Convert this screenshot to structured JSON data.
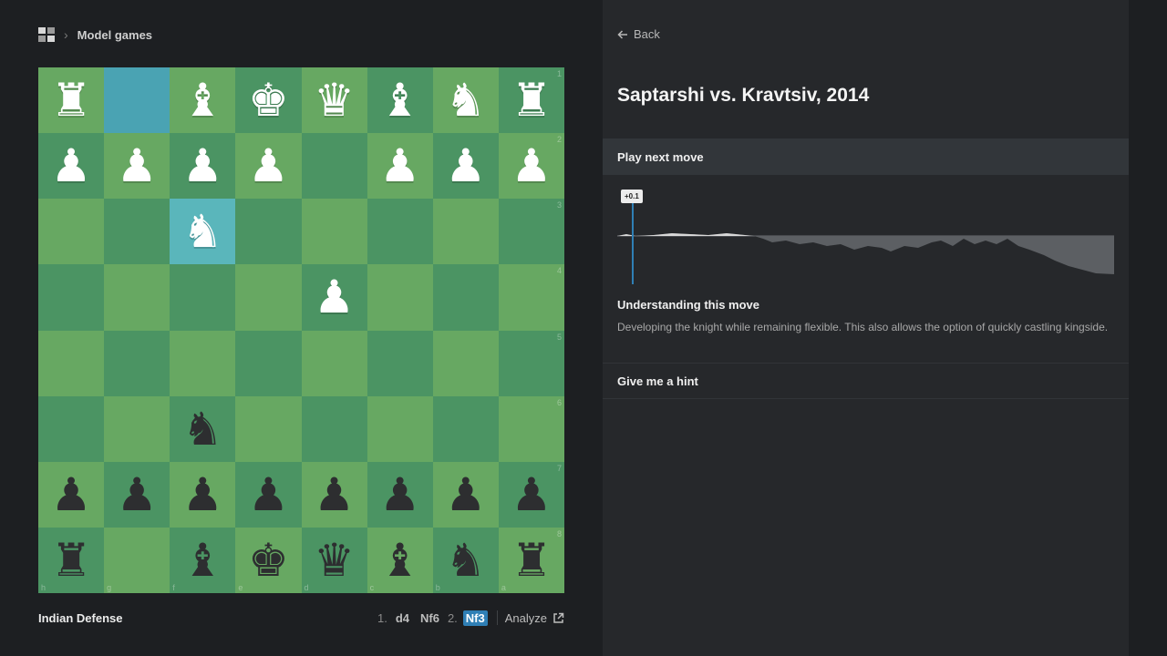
{
  "breadcrumb": {
    "section": "Model games"
  },
  "board": {
    "squares": [
      [
        "♜",
        "",
        "♝",
        "♚",
        "♛",
        "♝",
        "♞",
        "♜"
      ],
      [
        "♟",
        "♟",
        "♟",
        "♟",
        "",
        "♟",
        "♟",
        "♟"
      ],
      [
        "",
        "",
        "♞",
        "",
        "",
        "",
        "",
        ""
      ],
      [
        "",
        "",
        "",
        "",
        "♟",
        "",
        "",
        ""
      ],
      [
        "",
        "",
        "",
        "",
        "",
        "",
        "",
        ""
      ],
      [
        "",
        "",
        "♞",
        "",
        "",
        "",
        "",
        ""
      ],
      [
        "♟",
        "♟",
        "♟",
        "♟",
        "♟",
        "♟",
        "♟",
        "♟"
      ],
      [
        "♜",
        "",
        "♝",
        "♚",
        "♛",
        "♝",
        "♞",
        "♜"
      ]
    ],
    "colors": [
      [
        "w",
        "w",
        "w",
        "w",
        "w",
        "w",
        "w",
        "w"
      ],
      [
        "w",
        "w",
        "w",
        "w",
        "",
        "w",
        "w",
        "w"
      ],
      [
        "",
        "",
        "w",
        "",
        "",
        "",
        "",
        ""
      ],
      [
        "",
        "",
        "",
        "",
        "w",
        "",
        "",
        ""
      ],
      [
        "",
        "",
        "",
        "",
        "",
        "",
        "",
        ""
      ],
      [
        "",
        "",
        "b",
        "",
        "",
        "",
        "",
        ""
      ],
      [
        "b",
        "b",
        "b",
        "b",
        "b",
        "b",
        "b",
        "b"
      ],
      [
        "b",
        "",
        "b",
        "b",
        "b",
        "b",
        "b",
        "b"
      ]
    ],
    "ranks": [
      "1",
      "2",
      "3",
      "4",
      "5",
      "6",
      "7",
      "8"
    ],
    "files": [
      "h",
      "g",
      "f",
      "e",
      "d",
      "c",
      "b",
      "a"
    ],
    "highlight_from": "g1",
    "highlight_to": "f3"
  },
  "footer": {
    "opening": "Indian Defense",
    "moves": [
      {
        "num": "1.",
        "white": "d4",
        "black": "Nf6"
      },
      {
        "num": "2.",
        "white": "Nf3",
        "black": ""
      }
    ],
    "current_move": "Nf3",
    "analyze_label": "Analyze"
  },
  "panel": {
    "back_label": "Back",
    "game_title": "Saptarshi vs. Kravtsiv, 2014",
    "play_next_label": "Play next move",
    "eval_label": "+0.1",
    "understanding_title": "Understanding this move",
    "understanding_text": "Developing the knight while remaining flexible. This also allows the option of quickly castling kingside.",
    "hint_label": "Give me a hint"
  },
  "colors": {
    "light_square": "#67a862",
    "dark_square": "#4b9463",
    "highlight": "#4aa3b3",
    "accent": "#2f7fb5"
  }
}
